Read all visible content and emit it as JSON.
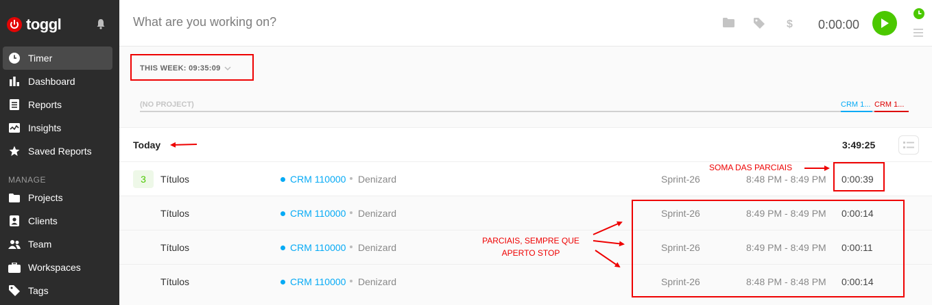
{
  "sidebar": {
    "brand": "toggl",
    "nav": [
      {
        "label": "Timer",
        "icon": "clock-icon",
        "active": true
      },
      {
        "label": "Dashboard",
        "icon": "bar-chart-icon"
      },
      {
        "label": "Reports",
        "icon": "document-icon"
      },
      {
        "label": "Insights",
        "icon": "insights-icon"
      },
      {
        "label": "Saved Reports",
        "icon": "star-icon"
      }
    ],
    "manage_label": "MANAGE",
    "manage": [
      {
        "label": "Projects",
        "icon": "folder-icon"
      },
      {
        "label": "Clients",
        "icon": "client-icon"
      },
      {
        "label": "Team",
        "icon": "team-icon"
      },
      {
        "label": "Workspaces",
        "icon": "briefcase-icon"
      },
      {
        "label": "Tags",
        "icon": "tag-icon"
      }
    ]
  },
  "topbar": {
    "placeholder": "What are you working on?",
    "timer": "0:00:00"
  },
  "week": {
    "summary": "THIS WEEK: 09:35:09"
  },
  "project_bar": {
    "no_project": "(NO PROJECT)",
    "crm_a": "CRM 1...",
    "crm_b": "CRM 1..."
  },
  "day": {
    "title": "Today",
    "total": "3:49:25"
  },
  "entries": [
    {
      "count": "3",
      "description": "Títulos",
      "project": "CRM 110000",
      "client": "Denizard",
      "tag": "Sprint-26",
      "range": "8:48 PM - 8:49 PM",
      "duration": "0:00:39"
    },
    {
      "description": "Títulos",
      "project": "CRM 110000",
      "client": "Denizard",
      "tag": "Sprint-26",
      "range": "8:49 PM - 8:49 PM",
      "duration": "0:00:14"
    },
    {
      "description": "Títulos",
      "project": "CRM 110000",
      "client": "Denizard",
      "tag": "Sprint-26",
      "range": "8:49 PM - 8:49 PM",
      "duration": "0:00:11"
    },
    {
      "description": "Títulos",
      "project": "CRM 110000",
      "client": "Denizard",
      "tag": "Sprint-26",
      "range": "8:48 PM - 8:48 PM",
      "duration": "0:00:14"
    }
  ],
  "annotations": {
    "soma": "SOMA DAS PARCIAIS",
    "parciais_line1": "PARCIAIS, SEMPRE QUE",
    "parciais_line2": "APERTO STOP"
  },
  "colors": {
    "sidebar_bg": "#2c2c2c",
    "brand_red": "#e20505",
    "play_green": "#4bc800",
    "project_blue": "#06aaf5",
    "annotation_red": "#e00"
  }
}
